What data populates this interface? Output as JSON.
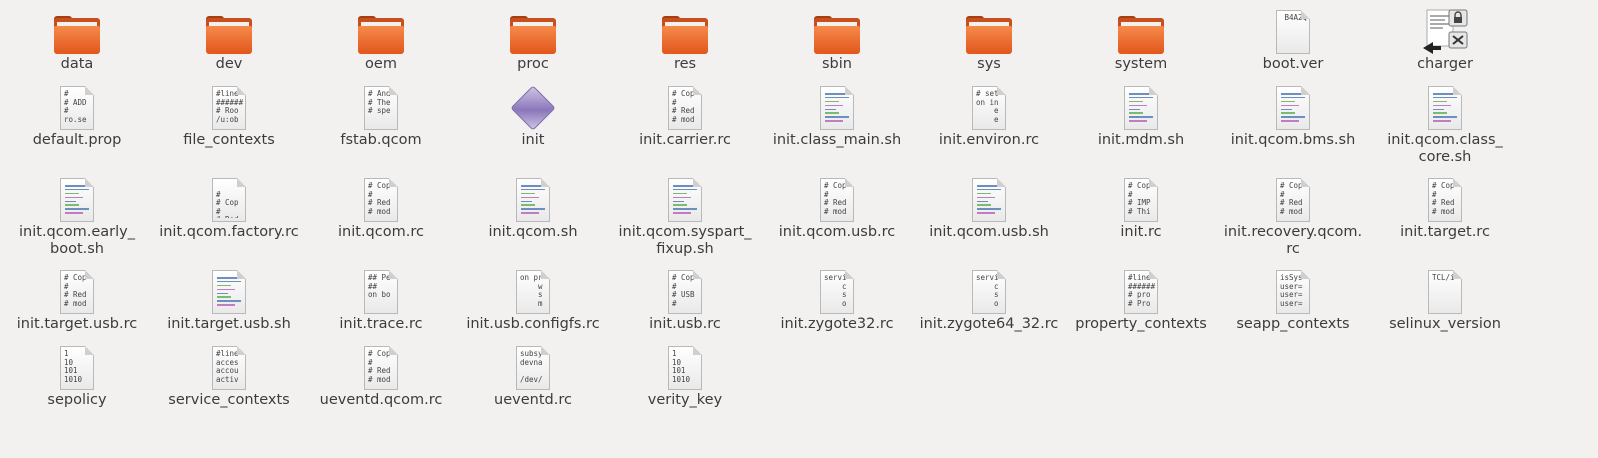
{
  "files": [
    [
      {
        "name": "data",
        "kind": "folder"
      },
      {
        "name": "dev",
        "kind": "folder"
      },
      {
        "name": "oem",
        "kind": "folder"
      },
      {
        "name": "proc",
        "kind": "folder"
      },
      {
        "name": "res",
        "kind": "folder"
      },
      {
        "name": "sbin",
        "kind": "folder"
      },
      {
        "name": "sys",
        "kind": "folder"
      },
      {
        "name": "system",
        "kind": "folder"
      },
      {
        "name": "boot.ver",
        "kind": "text",
        "preview": " B4A2Q"
      },
      {
        "name": "charger",
        "kind": "executable"
      }
    ],
    [
      {
        "name": "default.prop",
        "kind": "text",
        "preview": "#\n# ADD\n#\nro.se"
      },
      {
        "name": "file_contexts",
        "kind": "text",
        "preview": "#line\n######\n# Roo\n/u:ob"
      },
      {
        "name": "fstab.qcom",
        "kind": "text",
        "preview": "# And\n# The\n# spe"
      },
      {
        "name": "init",
        "kind": "binary"
      },
      {
        "name": "init.carrier.rc",
        "kind": "text",
        "preview": "# Cop\n#\n# Red\n# mod"
      },
      {
        "name": "init.class_main.sh",
        "kind": "script"
      },
      {
        "name": "init.environ.rc",
        "kind": "text",
        "preview": "# set\non in\n    e\n    e"
      },
      {
        "name": "init.mdm.sh",
        "kind": "script"
      },
      {
        "name": "init.qcom.bms.sh",
        "kind": "script"
      },
      {
        "name": "init.qcom.class_\ncore.sh",
        "kind": "script"
      }
    ],
    [
      {
        "name": "init.qcom.early_\nboot.sh",
        "kind": "script"
      },
      {
        "name": "init.qcom.factory.rc",
        "kind": "text",
        "preview": "\n#\n# Cop\n#\n# Red"
      },
      {
        "name": "init.qcom.rc",
        "kind": "text",
        "preview": "# Cop\n#\n# Red\n# mod"
      },
      {
        "name": "init.qcom.sh",
        "kind": "script"
      },
      {
        "name": "init.qcom.syspart_\nfixup.sh",
        "kind": "script"
      },
      {
        "name": "init.qcom.usb.rc",
        "kind": "text",
        "preview": "# Cop\n#\n# Red\n# mod"
      },
      {
        "name": "init.qcom.usb.sh",
        "kind": "script"
      },
      {
        "name": "init.rc",
        "kind": "text",
        "preview": "# Cop\n#\n# IMP\n# Thi"
      },
      {
        "name": "init.recovery.qcom.\nrc",
        "kind": "text",
        "preview": "# Cop\n#\n# Red\n# mod"
      },
      {
        "name": "init.target.rc",
        "kind": "text",
        "preview": "# Cop\n#\n# Red\n# mod"
      }
    ],
    [
      {
        "name": "init.target.usb.rc",
        "kind": "text",
        "preview": "# Cop\n#\n# Red\n# mod"
      },
      {
        "name": "init.target.usb.sh",
        "kind": "script"
      },
      {
        "name": "init.trace.rc",
        "kind": "text",
        "preview": "## Pe\n##\non bo"
      },
      {
        "name": "init.usb.configfs.rc",
        "kind": "text",
        "preview": "on pr\n    w\n    s\n    m"
      },
      {
        "name": "init.usb.rc",
        "kind": "text",
        "preview": "# Cop\n#\n# USB\n#"
      },
      {
        "name": "init.zygote32.rc",
        "kind": "text",
        "preview": "servi\n    c\n    s\n    o"
      },
      {
        "name": "init.zygote64_32.rc",
        "kind": "text",
        "preview": "servi\n    c\n    s\n    o"
      },
      {
        "name": "property_contexts",
        "kind": "text",
        "preview": "#line\n######\n# pro\n# Pro"
      },
      {
        "name": "seapp_contexts",
        "kind": "text",
        "preview": "isSys\nuser=\nuser=\nuser="
      },
      {
        "name": "selinux_version",
        "kind": "text",
        "preview": "TCL/i"
      }
    ],
    [
      {
        "name": "sepolicy",
        "kind": "text",
        "preview": "1\n10\n101\n1010"
      },
      {
        "name": "service_contexts",
        "kind": "text",
        "preview": "#line\nacces\naccou\nactiv"
      },
      {
        "name": "ueventd.qcom.rc",
        "kind": "text",
        "preview": "# Cop\n#\n# Red\n# mod"
      },
      {
        "name": "ueventd.rc",
        "kind": "text",
        "preview": "subsy\ndevna\n\n/dev/"
      },
      {
        "name": "verity_key",
        "kind": "text",
        "preview": "1\n10\n101\n1010"
      }
    ]
  ]
}
